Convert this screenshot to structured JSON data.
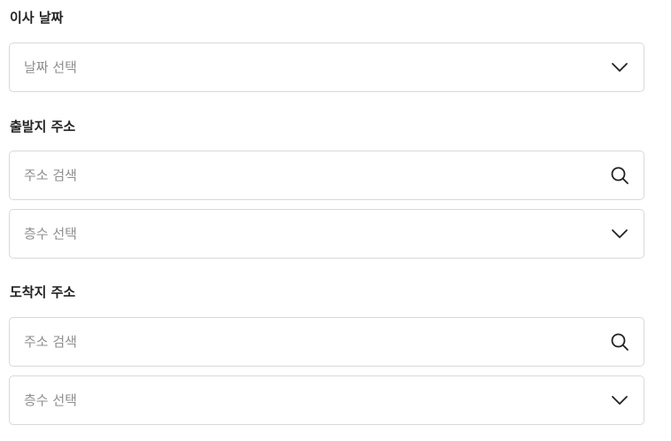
{
  "move_date": {
    "label": "이사 날짜",
    "select_placeholder": "날짜 선택",
    "icon": "chevron-down-icon"
  },
  "origin": {
    "label": "출발지 주소",
    "search_placeholder": "주소 검색",
    "search_icon": "search-icon",
    "floor_placeholder": "층수 선택",
    "floor_icon": "chevron-down-icon"
  },
  "destination": {
    "label": "도착지 주소",
    "search_placeholder": "주소 검색",
    "search_icon": "search-icon",
    "floor_placeholder": "층수 선택",
    "floor_icon": "chevron-down-icon"
  },
  "colors": {
    "label_text": "#222222",
    "placeholder_text": "#8e8e8e",
    "field_border": "#d9d9d9",
    "icon_stroke": "#222222"
  }
}
